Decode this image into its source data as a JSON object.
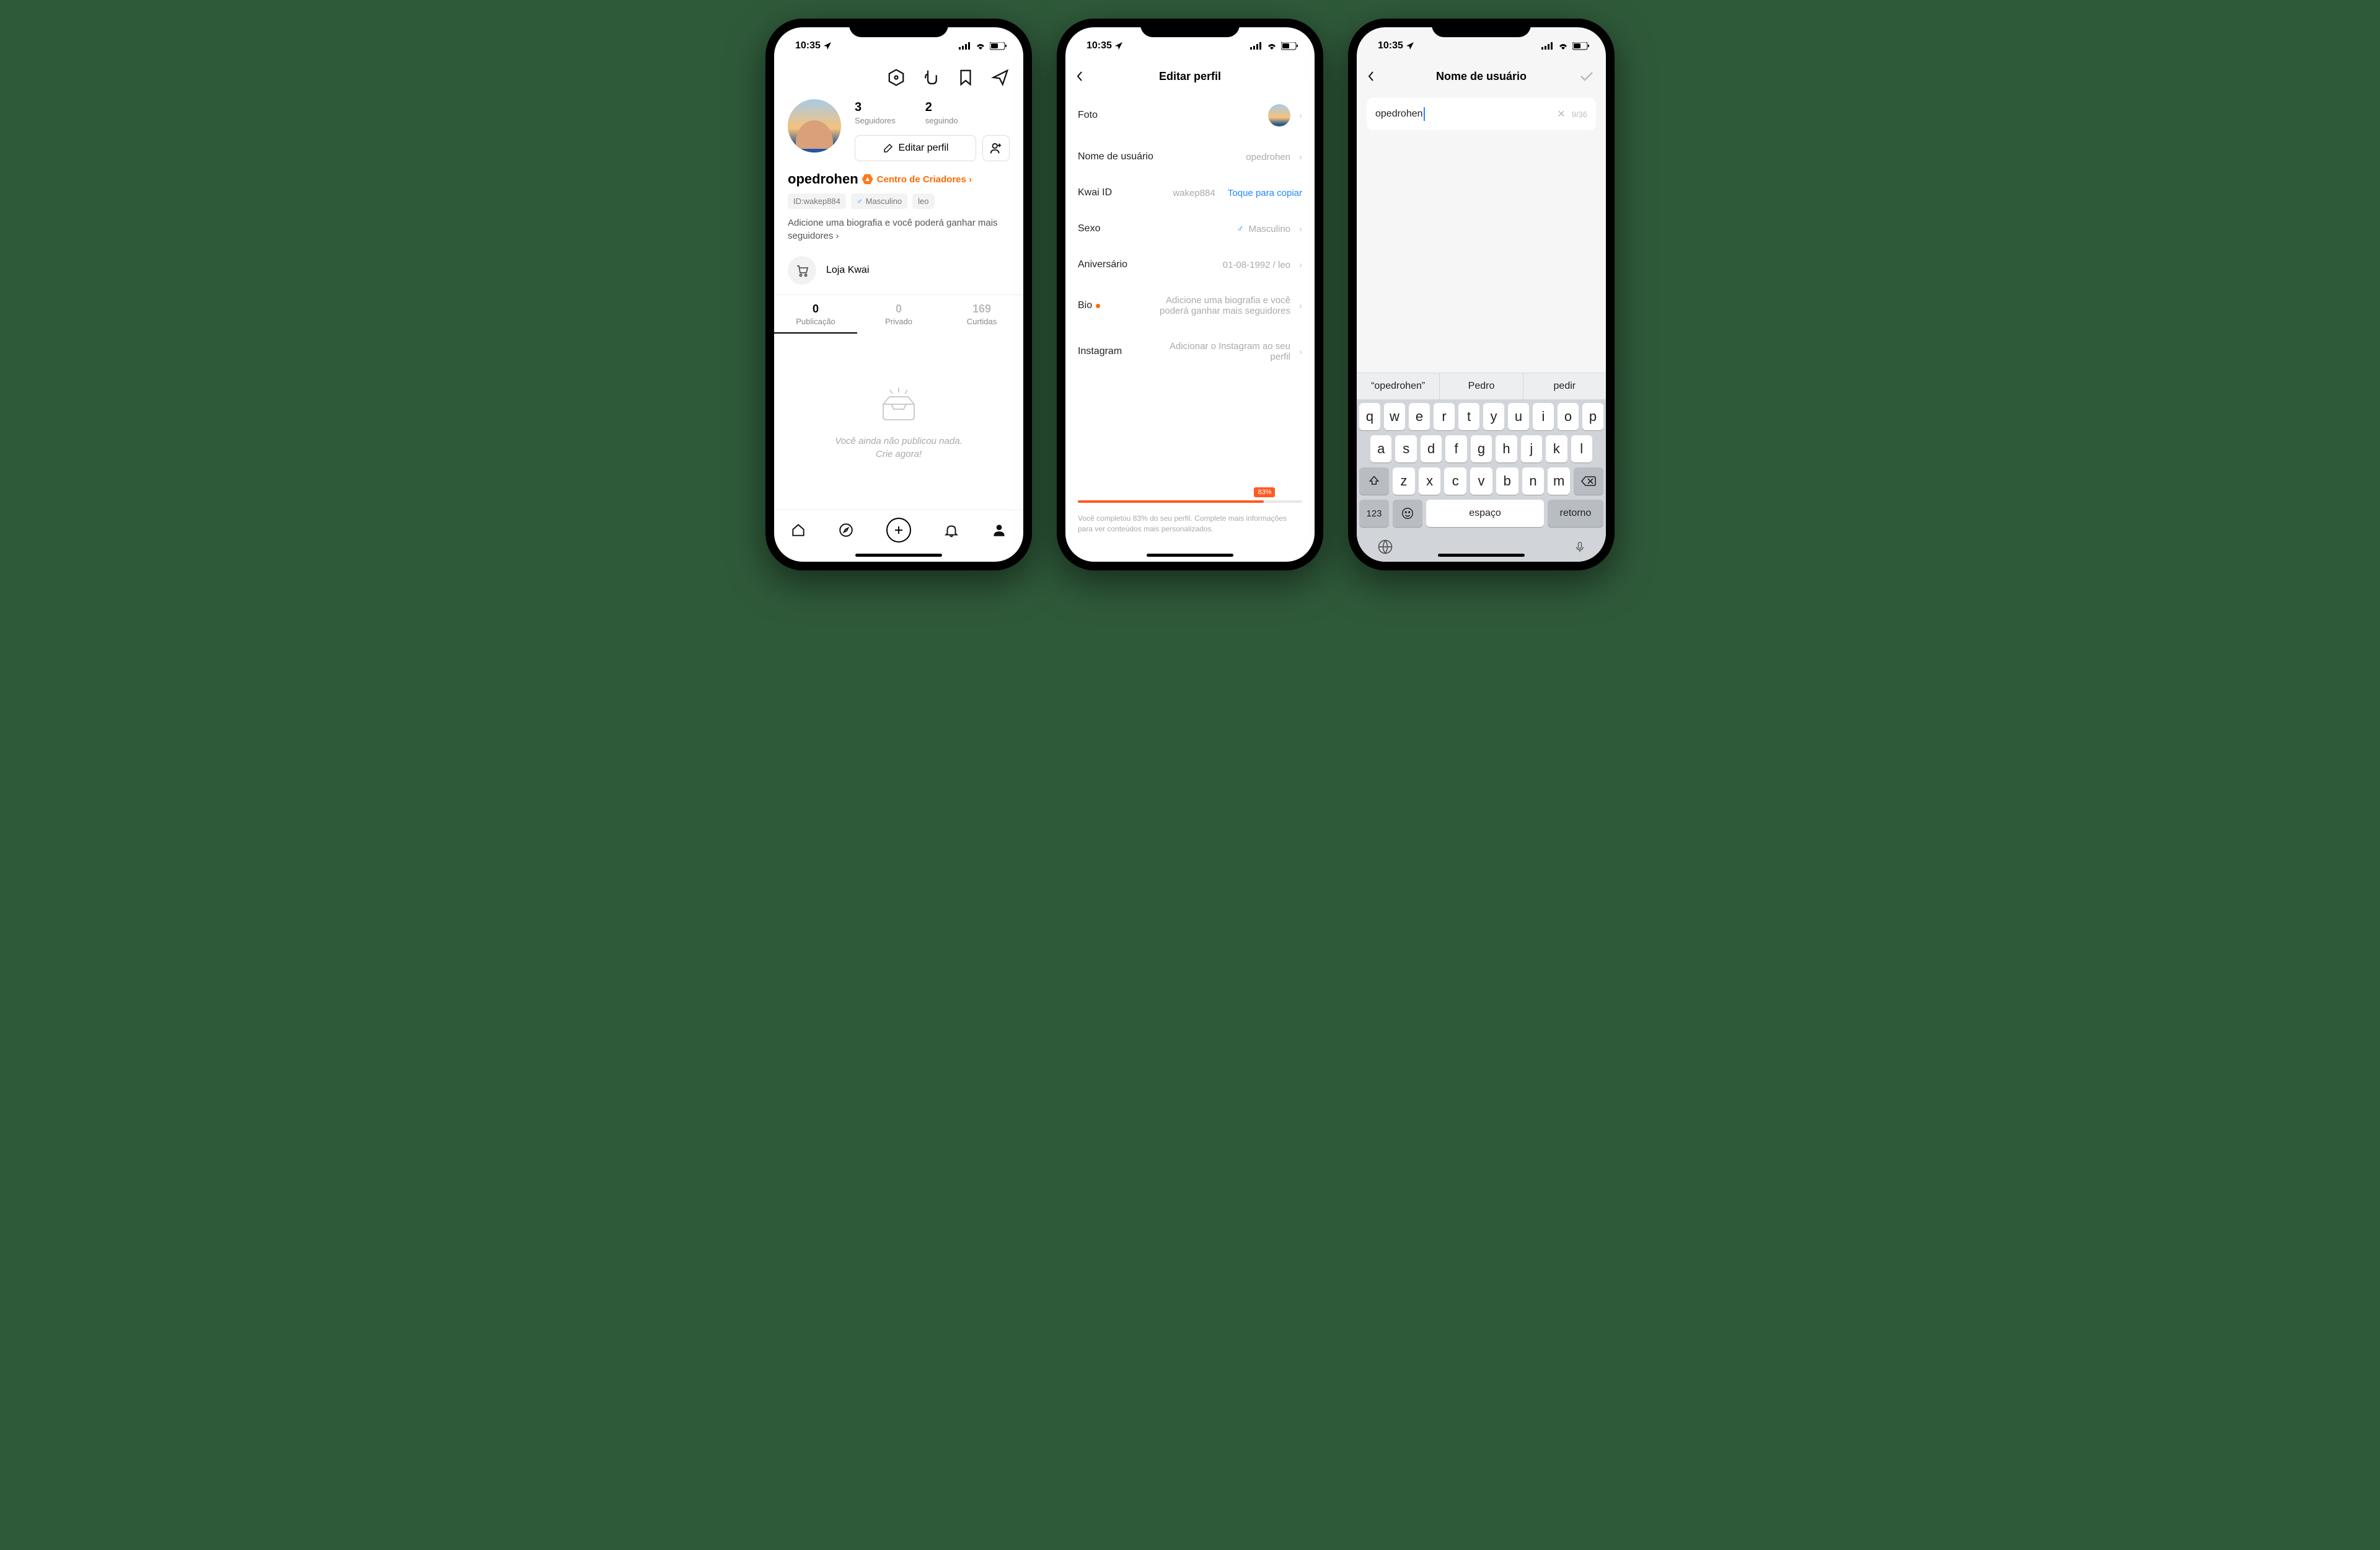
{
  "status": {
    "time": "10:35"
  },
  "phone1": {
    "stats": {
      "followers_n": "3",
      "followers_l": "Seguidores",
      "following_n": "2",
      "following_l": "seguindo"
    },
    "edit_button": "Editar perfil",
    "username": "opedrohen",
    "creator_center": "Centro de Criadores",
    "chips": {
      "id": "ID:wakep884",
      "gender": "Masculino",
      "zodiac": "leo"
    },
    "bio_cta": "Adicione uma biografia e você poderá ganhar mais seguidores",
    "store": "Loja Kwai",
    "tabs": {
      "pub_n": "0",
      "pub_l": "Publicação",
      "priv_n": "0",
      "priv_l": "Privado",
      "likes_n": "169",
      "likes_l": "Curtidas"
    },
    "empty1": "Você ainda não publicou nada.",
    "empty2": "Crie agora!"
  },
  "phone2": {
    "title": "Editar perfil",
    "rows": {
      "foto": "Foto",
      "username_l": "Nome de usuário",
      "username_v": "opedrohen",
      "kwaiid_l": "Kwai ID",
      "kwaiid_v": "wakep884",
      "copy": "Toque para copiar",
      "sexo_l": "Sexo",
      "sexo_v": "Masculino",
      "aniv_l": "Aniversário",
      "aniv_v": "01-08-1992 / leo",
      "bio_l": "Bio",
      "bio_v": "Adicione uma biografia e você poderá ganhar mais seguidores",
      "insta_l": "Instagram",
      "insta_v": "Adicionar o Instagram ao seu perfil"
    },
    "progress_pct": "83%",
    "progress_text": "Você completou 83% do  seu perfil. Complete mais informações para ver conteúdos mais personalizados."
  },
  "phone3": {
    "title": "Nome de usuário",
    "input_value": "opedrohen",
    "counter": "9/36",
    "suggestions": {
      "s1": "“opedrohen”",
      "s2": "Pedro",
      "s3": "pedir"
    },
    "keys": {
      "r1": [
        "q",
        "w",
        "e",
        "r",
        "t",
        "y",
        "u",
        "i",
        "o",
        "p"
      ],
      "r2": [
        "a",
        "s",
        "d",
        "f",
        "g",
        "h",
        "j",
        "k",
        "l"
      ],
      "r3": [
        "z",
        "x",
        "c",
        "v",
        "b",
        "n",
        "m"
      ],
      "num": "123",
      "space": "espaço",
      "ret": "retorno"
    }
  }
}
